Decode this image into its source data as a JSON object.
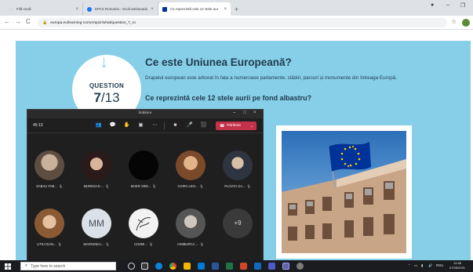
{
  "browser": {
    "tabs": [
      {
        "label": "Filă nouă",
        "favicon_color": "#dadce0",
        "active": false
      },
      {
        "label": "EPAS Romania - Scoli-ambasado",
        "favicon_color": "#1877f2",
        "active": false
      },
      {
        "label": "Ce reprezintă cele 12 stele aur",
        "favicon_color": "#003399",
        "active": true
      }
    ],
    "new_tab": "+",
    "address": "europa.eu/learning-corner/quiz/what/question_7_ro"
  },
  "quiz": {
    "badge_label": "QUESTION",
    "badge_current": "7",
    "badge_total": "/13",
    "title": "Ce este Uniunea Europeană?",
    "body": "Drapelul european este arborat în fața a numeroase parlamente, clădiri, parcuri și monumente din întreaga Europă.",
    "question": "Ce reprezintă cele 12 stele aurii pe fond albastru?"
  },
  "teams": {
    "window_title": "Întâlnire",
    "timer": "45:13",
    "leave_label": "Părăsire",
    "participants": [
      {
        "name": "SABAU FAB...",
        "avatar": "photo",
        "color": "#7a6a5c"
      },
      {
        "name": "MURESAN ...",
        "avatar": "photo",
        "color": "#5a3a3a"
      },
      {
        "name": "MAER SIMI...",
        "avatar": "photo",
        "color": "#050505"
      },
      {
        "name": "CHIRA LEO...",
        "avatar": "photo",
        "color": "#b07a4a"
      },
      {
        "name": "PLOATA GA...",
        "avatar": "photo",
        "color": "#6a7a8a"
      },
      {
        "name": "UTIU DIAN...",
        "avatar": "photo",
        "color": "#8a6a4a"
      },
      {
        "name": "MARGINEA...",
        "avatar": "initials",
        "initials": "MM"
      },
      {
        "name": "COZMI...",
        "avatar": "photo",
        "color": "#efefef"
      },
      {
        "name": "IAMBURCA ...",
        "avatar": "photo",
        "color": "#6a6a6a"
      }
    ],
    "overflow": "+9"
  },
  "taskbar": {
    "search_placeholder": "Type here to search",
    "language": "ROU",
    "time": "12:48",
    "date": "07/05/2021"
  },
  "colors": {
    "quiz_bg": "#87cfe8",
    "leave_red": "#c4314b",
    "teams_bg": "#1f1f1f"
  }
}
